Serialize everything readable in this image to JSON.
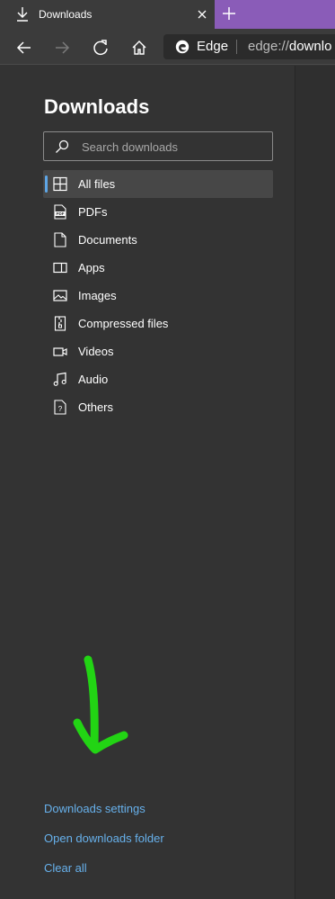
{
  "tab": {
    "title": "Downloads"
  },
  "address_bar": {
    "brand": "Edge",
    "url_prefix": "edge://",
    "url_rest": "downlo"
  },
  "page": {
    "title": "Downloads"
  },
  "search": {
    "placeholder": "Search downloads",
    "value": ""
  },
  "nav": {
    "selected": "All files",
    "items": [
      {
        "label": "All files",
        "icon": "grid-icon"
      },
      {
        "label": "PDFs",
        "icon": "pdf-icon"
      },
      {
        "label": "Documents",
        "icon": "document-icon"
      },
      {
        "label": "Apps",
        "icon": "app-icon"
      },
      {
        "label": "Images",
        "icon": "image-icon"
      },
      {
        "label": "Compressed files",
        "icon": "zip-icon"
      },
      {
        "label": "Videos",
        "icon": "video-icon"
      },
      {
        "label": "Audio",
        "icon": "audio-icon"
      },
      {
        "label": "Others",
        "icon": "unknown-file-icon"
      }
    ]
  },
  "links": {
    "settings": "Downloads settings",
    "open_folder": "Open downloads folder",
    "clear_all": "Clear all"
  },
  "colors": {
    "tabstrip": "#8a5cb8",
    "background": "#333333",
    "link": "#67b1ec",
    "accent": "#5ea6e6",
    "annotation": "#22d414"
  }
}
